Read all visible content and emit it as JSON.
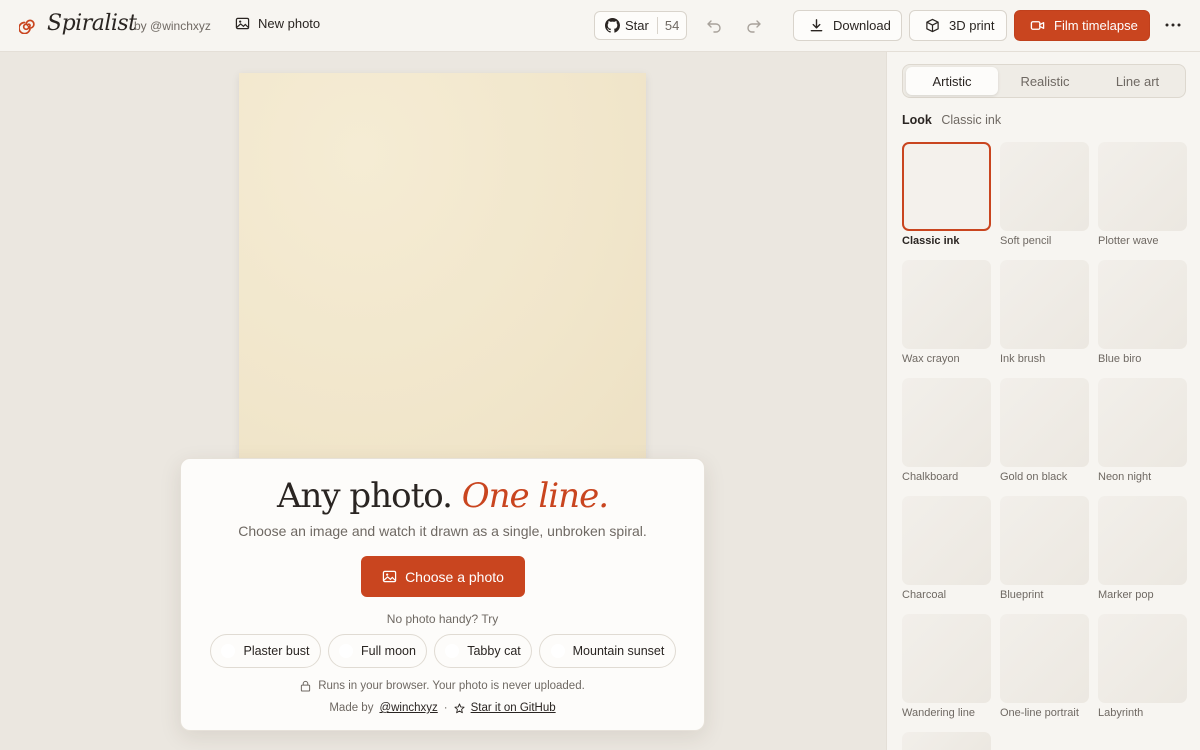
{
  "header": {
    "brand": "Spiralist",
    "byline": "by @winchxyz",
    "new_photo_label": "New photo",
    "star_label": "Star",
    "star_count": "54",
    "download_label": "Download",
    "print_label": "3D print",
    "film_label": "Film timelapse"
  },
  "hero": {
    "title_plain": "Any photo.",
    "title_accent": "One line.",
    "subtitle": "Choose an image and watch it drawn as a single, unbroken spiral.",
    "choose_label": "Choose a photo",
    "no_photo": "No photo handy? Try",
    "samples": [
      "Plaster bust",
      "Full moon",
      "Tabby cat",
      "Mountain sunset"
    ],
    "privacy": "Runs in your browser. Your photo is never uploaded.",
    "made_by": "Made by",
    "author_link": "@winchxyz",
    "dot": "·",
    "github_link": "Star it on GitHub"
  },
  "panel": {
    "tabs": [
      "Artistic",
      "Realistic",
      "Line art"
    ],
    "active_tab": "Artistic",
    "look_key": "Look",
    "look_value": "Classic ink",
    "styles": [
      "Classic ink",
      "Soft pencil",
      "Plotter wave",
      "Wax crayon",
      "Ink brush",
      "Blue biro",
      "Chalkboard",
      "Gold on black",
      "Neon night",
      "Charcoal",
      "Blueprint",
      "Marker pop",
      "Wandering line",
      "One-line portrait",
      "Labyrinth"
    ],
    "selected_style": "Classic ink"
  },
  "colors": {
    "accent": "#c9451f",
    "paper": "#f3e9cf",
    "background": "#ebe7e0"
  }
}
